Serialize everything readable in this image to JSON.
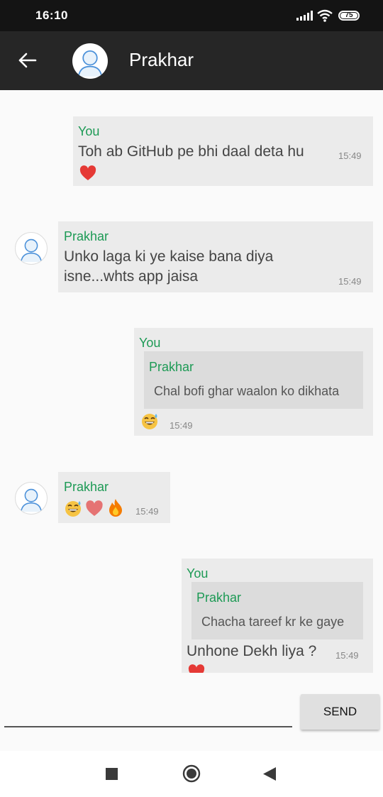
{
  "status": {
    "time": "16:10",
    "battery": "75"
  },
  "header": {
    "contact_name": "Prakhar"
  },
  "messages": [
    {
      "sender": "You",
      "text": "Toh ab GitHub pe bhi daal deta hu",
      "time": "15:49",
      "reaction": "heart"
    },
    {
      "sender": "Prakhar",
      "text_line1": "Unko laga ki ye kaise bana diya",
      "text_line2": "isne...whts app jaisa",
      "time": "15:49"
    },
    {
      "sender": "You",
      "quote_sender": "Prakhar",
      "quote_text": "Chal bofi ghar waalon ko dikhata",
      "time": "15:49",
      "reaction": "grin-sweat"
    },
    {
      "sender": "Prakhar",
      "time": "15:49",
      "emojis": [
        "grin-sweat",
        "heart",
        "fire"
      ]
    },
    {
      "sender": "You",
      "quote_sender": "Prakhar",
      "quote_text": "Chacha tareef kr ke gaye",
      "text": "Unhone Dekh liya ?",
      "time": "15:49",
      "reaction": "heart"
    }
  ],
  "composer": {
    "send_label": "SEND",
    "input_value": ""
  }
}
